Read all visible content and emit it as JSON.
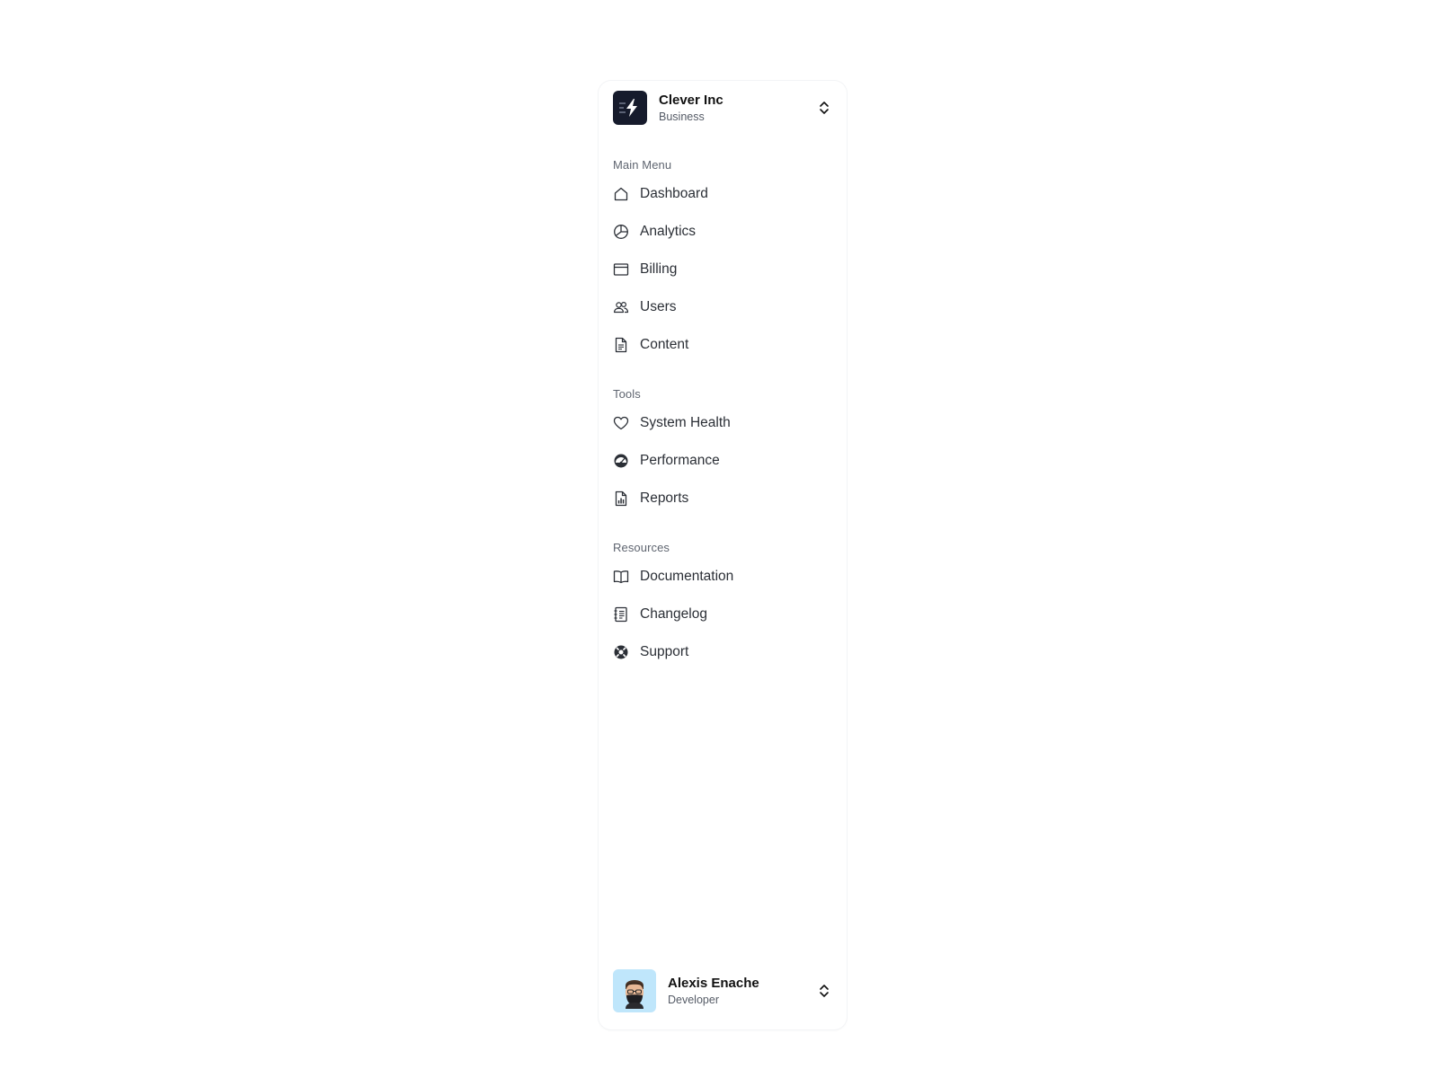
{
  "team": {
    "name": "Clever Inc",
    "plan": "Business",
    "logo_color": "#161b2c"
  },
  "sections": {
    "main": {
      "label": "Main Menu",
      "items": [
        {
          "label": "Dashboard",
          "icon": "home-icon"
        },
        {
          "label": "Analytics",
          "icon": "pie-chart-icon"
        },
        {
          "label": "Billing",
          "icon": "credit-card-icon"
        },
        {
          "label": "Users",
          "icon": "users-icon"
        },
        {
          "label": "Content",
          "icon": "document-icon"
        }
      ]
    },
    "tools": {
      "label": "Tools",
      "items": [
        {
          "label": "System Health",
          "icon": "heart-icon"
        },
        {
          "label": "Performance",
          "icon": "gauge-icon"
        },
        {
          "label": "Reports",
          "icon": "report-icon"
        }
      ]
    },
    "resources": {
      "label": "Resources",
      "items": [
        {
          "label": "Documentation",
          "icon": "book-icon"
        },
        {
          "label": "Changelog",
          "icon": "changelog-icon"
        },
        {
          "label": "Support",
          "icon": "lifebuoy-icon"
        }
      ]
    }
  },
  "user": {
    "name": "Alexis Enache",
    "role": "Developer",
    "avatar_bg": "#bfe6fb"
  }
}
